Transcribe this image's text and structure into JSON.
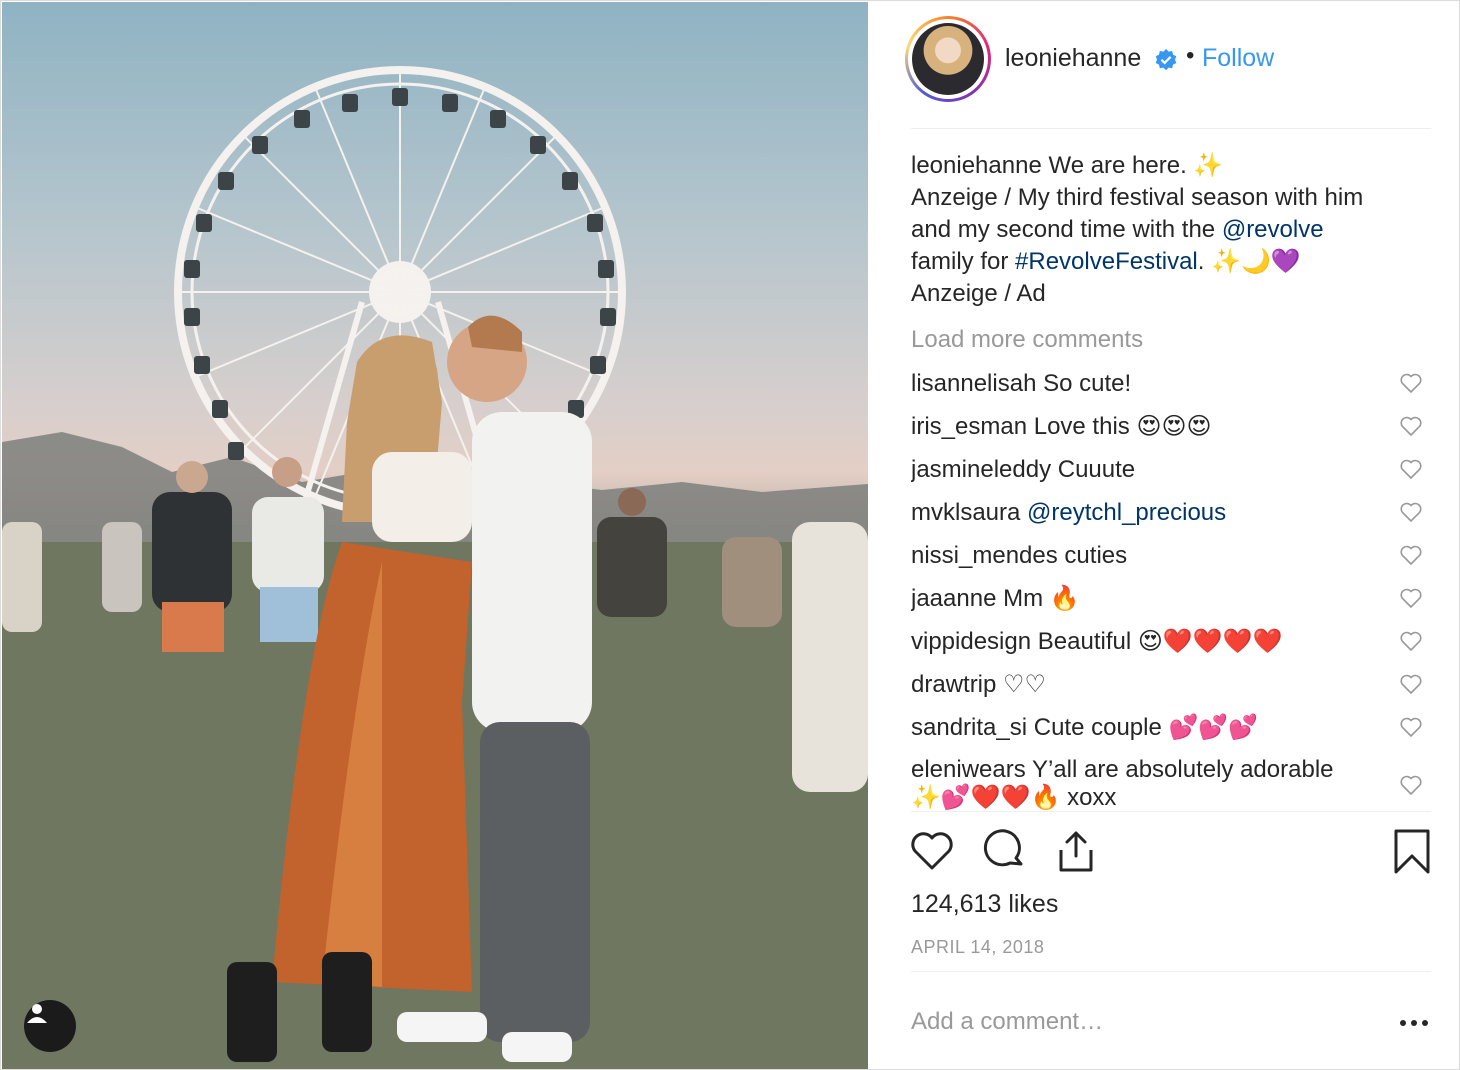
{
  "header": {
    "username": "leoniehanne",
    "separator": "•",
    "follow_label": "Follow"
  },
  "caption": {
    "username": "leoniehanne",
    "line1": "We are here. ✨",
    "line2": "Anzeige / My third festival season with him",
    "line3_pre": "and my second time with the ",
    "line3_link": "@revolve",
    "line4_pre": "family for ",
    "line4_link": "#RevolveFestival",
    "line4_post": ". ✨🌙💜",
    "line5": "Anzeige / Ad"
  },
  "load_more_label": "Load more comments",
  "comments": [
    {
      "username": "lisannelisah",
      "text": "So cute!"
    },
    {
      "username": "iris_esman",
      "text": "Love this 😍😍😍"
    },
    {
      "username": "jasmineleddy",
      "text": "Cuuute"
    },
    {
      "username": "mvklsaura",
      "text": "@reytchl_precious"
    },
    {
      "username": "nissi_mendes",
      "text": "cuties"
    },
    {
      "username": "jaaanne",
      "text": "Mm 🔥"
    },
    {
      "username": "vippidesign",
      "text": "Beautiful 😍❤️❤️❤️❤️"
    },
    {
      "username": "drawtrip",
      "text": "♡♡"
    },
    {
      "username": "sandrita_si",
      "text": "Cute couple 💕💕💕"
    },
    {
      "username": "eleniwears",
      "text": "Y’all are absolutely adorable",
      "text2": "✨💕❤️❤️🔥 xoxx"
    }
  ],
  "likes": "124,613 likes",
  "date": "APRIL 14, 2018",
  "add_comment_placeholder": "Add a comment…",
  "more_label": "•••",
  "colors": {
    "link": "#003569",
    "follow": "#3897f0",
    "muted": "#999999",
    "verified": "#3897f0"
  }
}
